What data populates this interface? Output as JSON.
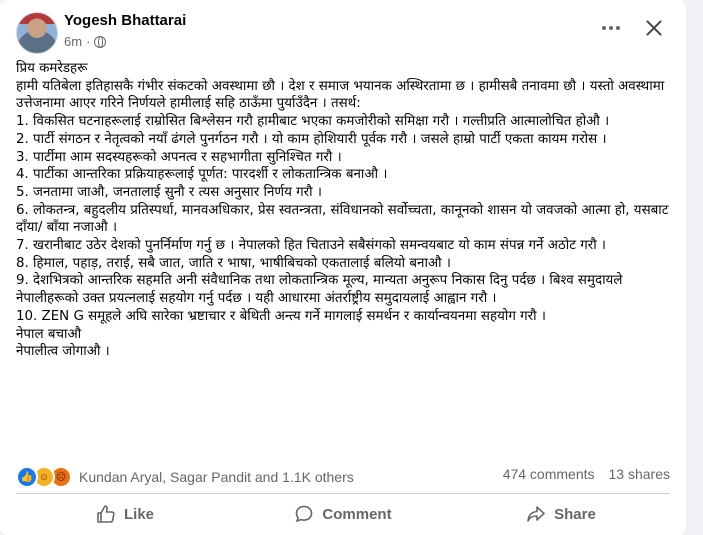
{
  "post": {
    "author": "Yogesh Bhattarai",
    "time": "6m",
    "separator": "·",
    "visibility_icon": "globe-icon"
  },
  "body": {
    "lines": [
      "प्रिय कमरेडहरू",
      "हामी यतिबेला इतिहासकै गंभीर संकटको अवस्थामा छौ । देश र समाज भयानक अस्थिरतामा छ । हामीसबै तनावमा छौ । यस्तो अवस्थामा उत्तेजनामा आएर गरिने निर्णयले हामीलाई सहि ठाऊँमा पुर्याउँदैन । तसर्थ:",
      "1. विकसित घटनाहरूलाई राम्रोसित बिश्लेसन गरौ हामीबाट भएका कमजोरीको समिक्षा गरौ । गल्तीप्रति आत्मालोचित होऔ ।",
      "2. पार्टी संगठन र नेतृत्वको नयाँ ढंगले पुनर्गठन गरौ । यो काम होशियारी पूर्वक गरौ । जसले हाम्रो पार्टी एकता कायम गरोस ।",
      "3. पार्टीमा आम सदस्यहरूको अपनत्व र सहभागीता सुनिश्चित गरौ ।",
      "4. पार्टीका आन्तरिका प्रक्रियाहरूलाई पूर्णत: पारदर्शी र लोकतान्त्रिक बनाऔ ।",
      "5. जनतामा जाऔ, जनतालाई सुनौ र त्यस अनुसार निर्णय गरौ ।",
      "6. लोकतन्त्र, बहुदलीय प्रतिस्पर्धा, मानवअधिकार, प्रेस स्वतन्त्रता, संविधानको सर्वोच्चता, कानूनको शासन यो जवजको आत्मा हो, यसबाट दाँया/ बाँया नजाऔ ।",
      "7. खरानीबाट उठेर देशको पुनर्निर्माण गर्नु छ । नेपालको हित चिताउने सबैसंगको समन्वयबाट यो काम संपन्न गर्ने अठोट गरौ ।",
      "8. हिमाल, पहाड़, तराई, सबै जात, जाति र भाषा, भाषीबिचको एकतालाई बलियो बनाऔ ।",
      "9. देशभित्रको आन्तरिक सहमति अनी संवैधानिक तथा लोकतान्त्रिक मूल्य, मान्यता अनुरूप निकास दिनु पर्दछ । बिश्व समुदायले नेपालीहरूको उक्त प्रयत्नलाई सहयोग गर्नु पर्दछ । यही आधारमा अंतर्राष्ट्रीय समुदायलाई आह्वान गरौ ।",
      "10. ZEN G समूहले अघि सारेका भ्रष्टाचार र बेथिती अन्त्य गर्ने मागलाई समर्थन र कार्यान्वयनमा सहयोग गरौ ।",
      "नेपाल बचाऔ",
      "नेपालीत्व जोगाऔ ।"
    ]
  },
  "reactions": {
    "icons": [
      "like-reaction-icon",
      "haha-reaction-icon",
      "angry-reaction-icon"
    ],
    "names": "Kundan Aryal, Sagar Pandit and 1.1K others",
    "comments": "474 comments",
    "shares": "13 shares"
  },
  "actions": {
    "like": "Like",
    "comment": "Comment",
    "share": "Share"
  },
  "colors": {
    "like_blue": "#1877f2",
    "secondary_text": "#65676b"
  }
}
